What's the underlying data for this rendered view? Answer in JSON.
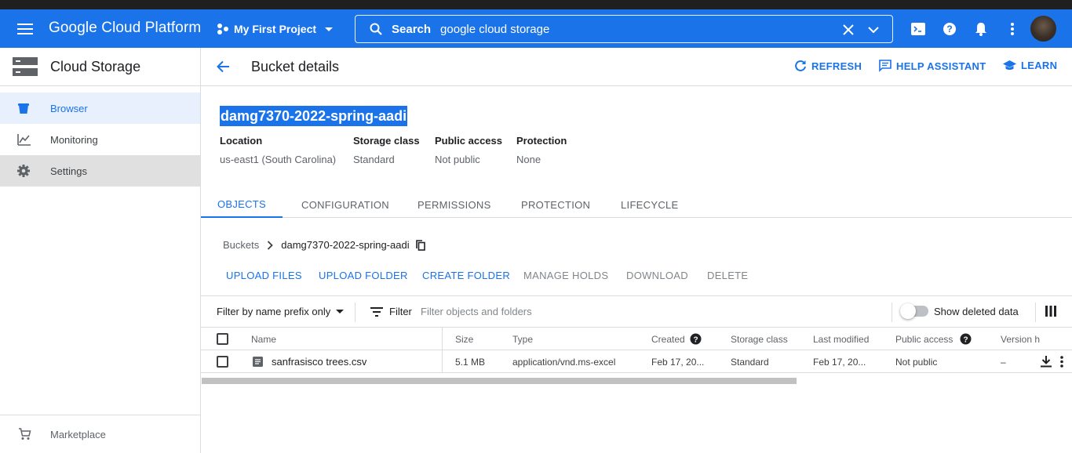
{
  "topbar": {
    "brand": "Google Cloud Platform",
    "project": "My First Project",
    "search_label": "Search",
    "search_value": "google cloud storage",
    "color": "#1a73e8"
  },
  "sidebar": {
    "title": "Cloud Storage",
    "items": [
      {
        "label": "Browser",
        "icon": "bucket-icon"
      },
      {
        "label": "Monitoring",
        "icon": "chart-icon"
      },
      {
        "label": "Settings",
        "icon": "gear-icon"
      }
    ],
    "footer": "Marketplace"
  },
  "header": {
    "title": "Bucket details",
    "refresh": "REFRESH",
    "help": "HELP ASSISTANT",
    "learn": "LEARN"
  },
  "bucket": {
    "name": "damg7370-2022-spring-aadi",
    "meta": [
      {
        "label": "Location",
        "value": "us-east1 (South Carolina)"
      },
      {
        "label": "Storage class",
        "value": "Standard"
      },
      {
        "label": "Public access",
        "value": "Not public"
      },
      {
        "label": "Protection",
        "value": "None"
      }
    ]
  },
  "tabs": [
    "OBJECTS",
    "CONFIGURATION",
    "PERMISSIONS",
    "PROTECTION",
    "LIFECYCLE"
  ],
  "breadcrumb": {
    "root": "Buckets",
    "current": "damg7370-2022-spring-aadi"
  },
  "actions": [
    "UPLOAD FILES",
    "UPLOAD FOLDER",
    "CREATE FOLDER",
    "MANAGE HOLDS",
    "DOWNLOAD",
    "DELETE"
  ],
  "filterbar": {
    "prefix": "Filter by name prefix only",
    "filter": "Filter",
    "placeholder": "Filter objects and folders",
    "deleted": "Show deleted data"
  },
  "table": {
    "columns": [
      "Name",
      "Size",
      "Type",
      "Created",
      "Storage class",
      "Last modified",
      "Public access",
      "Version h"
    ],
    "rows": [
      {
        "name": "sanfrasisco trees.csv",
        "size": "5.1 MB",
        "type": "application/vnd.ms-excel",
        "created": "Feb 17, 20...",
        "storage": "Standard",
        "modified": "Feb 17, 20...",
        "public": "Not public",
        "version": "–"
      }
    ]
  }
}
